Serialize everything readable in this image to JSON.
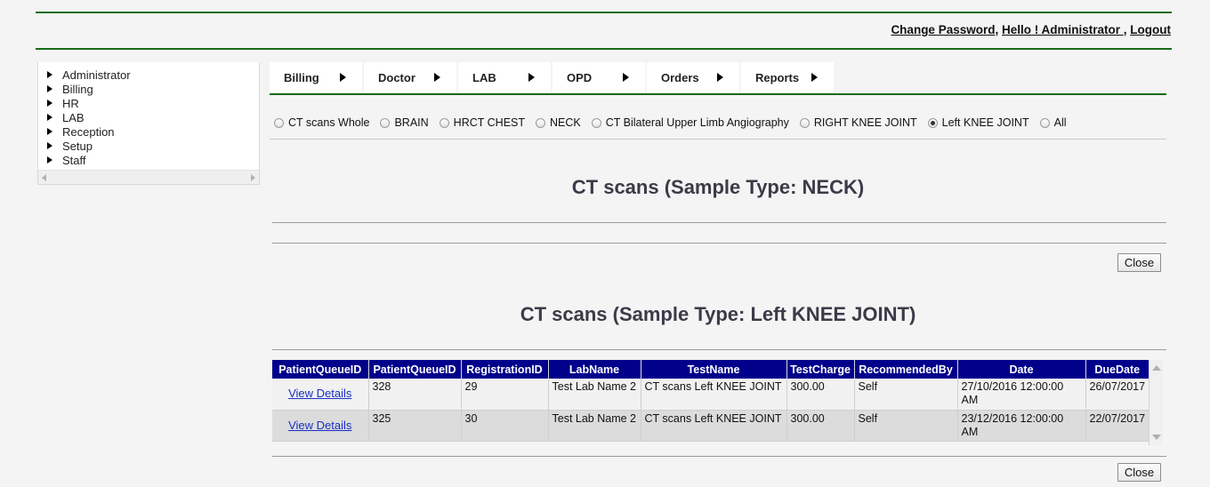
{
  "header": {
    "change_password": "Change Password",
    "comma": ", ",
    "greeting": "Hello ! Administrator ",
    "comma2": ", ",
    "logout": "Logout"
  },
  "sidebar": {
    "items": [
      {
        "label": "Administrator"
      },
      {
        "label": "Billing"
      },
      {
        "label": "HR"
      },
      {
        "label": "LAB"
      },
      {
        "label": "Reception"
      },
      {
        "label": "Setup"
      },
      {
        "label": "Staff"
      }
    ]
  },
  "menu": {
    "tabs": [
      {
        "label": "Billing"
      },
      {
        "label": "Doctor"
      },
      {
        "label": "LAB"
      },
      {
        "label": "OPD"
      },
      {
        "label": "Orders"
      },
      {
        "label": "Reports"
      }
    ]
  },
  "filters": {
    "options": [
      {
        "label": "CT scans Whole",
        "selected": false
      },
      {
        "label": "BRAIN",
        "selected": false
      },
      {
        "label": "HRCT CHEST",
        "selected": false
      },
      {
        "label": "NECK",
        "selected": false
      },
      {
        "label": "CT Bilateral Upper Limb Angiography",
        "selected": false
      },
      {
        "label": "RIGHT KNEE JOINT",
        "selected": false
      },
      {
        "label": "Left KNEE JOINT",
        "selected": true
      },
      {
        "label": "All",
        "selected": false
      }
    ]
  },
  "sections": {
    "neck_title": "CT scans (Sample Type: NECK)",
    "knee_title": "CT scans (Sample Type: Left KNEE JOINT)",
    "close_label_1": "Close",
    "close_label_2": "Close"
  },
  "table": {
    "columns": [
      "PatientQueueID",
      "PatientQueueID",
      "RegistrationID",
      "LabName",
      "TestName",
      "TestCharge",
      "RecommendedBy",
      "Date",
      "DueDate"
    ],
    "rows": [
      {
        "link": "View Details",
        "patient_queue_id": "328",
        "registration_id": "29",
        "lab_name": "Test Lab Name 2",
        "test_name": "CT scans Left KNEE JOINT",
        "test_charge": "300.00",
        "recommended_by": "Self",
        "date": "27/10/2016 12:00:00 AM",
        "due_date": "26/07/2017"
      },
      {
        "link": "View Details",
        "patient_queue_id": "325",
        "registration_id": "30",
        "lab_name": "Test Lab Name 2",
        "test_name": "CT scans Left KNEE JOINT",
        "test_charge": "300.00",
        "recommended_by": "Self",
        "date": "23/12/2016 12:00:00 AM",
        "due_date": "22/07/2017"
      }
    ]
  },
  "colors": {
    "green_rule": "#1a6b1a",
    "table_header": "#00008b",
    "link_blue": "#1a2fc4"
  }
}
